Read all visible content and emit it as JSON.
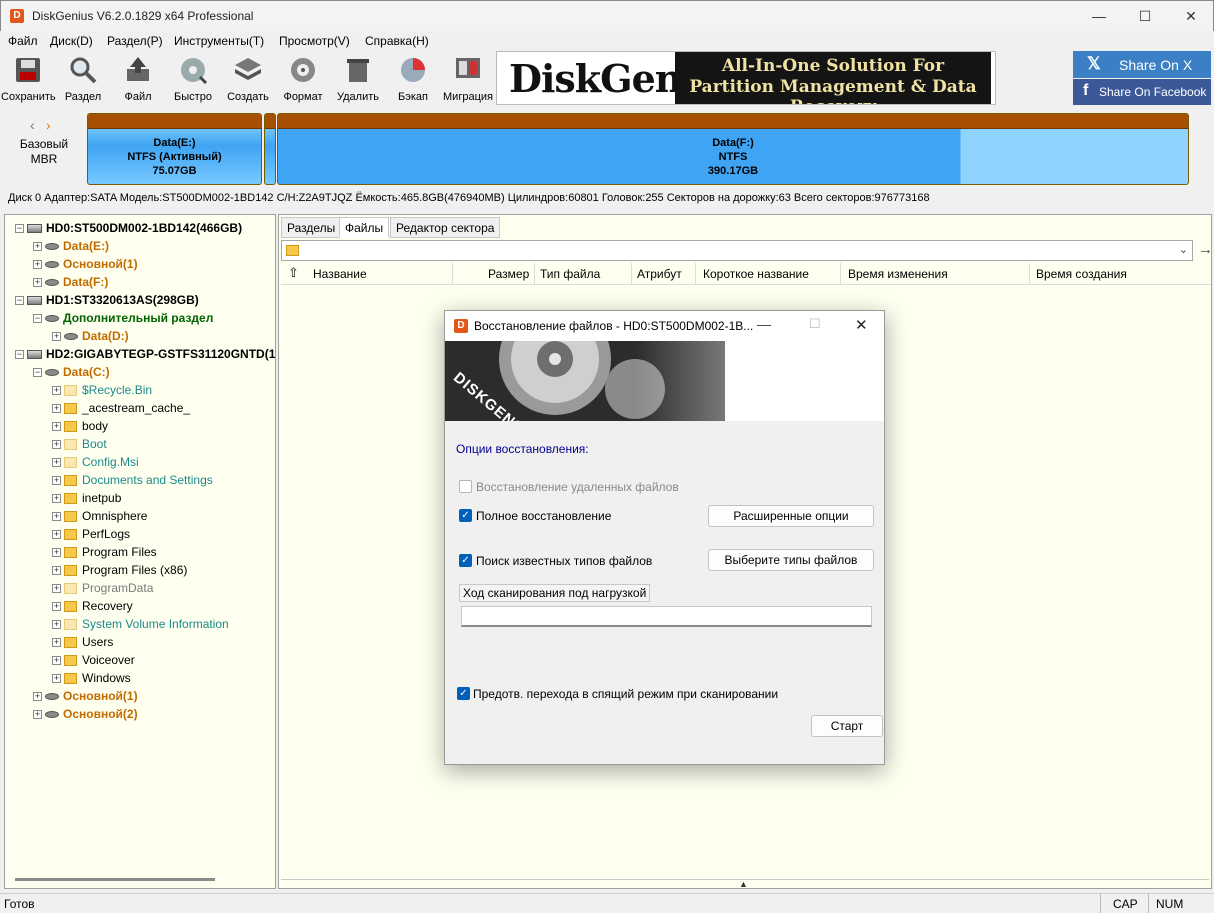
{
  "app": {
    "title": "DiskGenius V6.2.0.1829 x64 Professional",
    "icon_letter": "D"
  },
  "window_controls": {
    "minimize": "—",
    "maximize": "☐",
    "close": "✕"
  },
  "menu": [
    "Файл",
    "Диск(D)",
    "Раздел(P)",
    "Инструменты(T)",
    "Просмотр(V)",
    "Справка(H)"
  ],
  "toolbar": {
    "buttons": [
      {
        "label": "Сохранить",
        "icon": "save-icon"
      },
      {
        "label": "Раздел",
        "icon": "search-partition-icon"
      },
      {
        "label": "Файл",
        "icon": "file-recovery-icon"
      },
      {
        "label": "Быстро",
        "icon": "quick-partition-icon"
      },
      {
        "label": "Создать",
        "icon": "create-partition-icon"
      },
      {
        "label": "Формат",
        "icon": "format-icon"
      },
      {
        "label": "Удалить",
        "icon": "delete-icon"
      },
      {
        "label": "Бэкап",
        "icon": "backup-icon"
      },
      {
        "label": "Миграция",
        "icon": "migration-icon"
      }
    ]
  },
  "banner": {
    "logo": "DiskGenius",
    "tagline1": "All-In-One Solution For",
    "tagline2": "Partition Management & Data Recovery"
  },
  "share": {
    "x": "Share On X",
    "facebook": "Share On Facebook"
  },
  "disk_map": {
    "label_line1": "Базовый",
    "label_line2": "MBR",
    "partitions": [
      {
        "name": "Data(E:)",
        "fs": "NTFS (Активный)",
        "size": "75.07GB"
      },
      {
        "name": "Data(F:)",
        "fs": "NTFS",
        "size": "390.17GB"
      }
    ]
  },
  "disk_info": "Диск 0 Адаптер:SATA Модель:ST500DM002-1BD142 С/Н:Z2A9TJQZ Ёмкость:465.8GB(476940MB) Цилиндров:60801 Головок:255 Секторов на дорожку:63 Всего секторов:976773168",
  "tree": {
    "items": [
      {
        "text": "HD0:ST500DM002-1BD142(466GB)",
        "kind": "disk",
        "color": "c-disk",
        "level": 0,
        "expander": "−"
      },
      {
        "text": "Data(E:)",
        "kind": "part",
        "color": "c-orange",
        "level": 1,
        "expander": "+"
      },
      {
        "text": "Основной(1)",
        "kind": "part",
        "color": "c-orange",
        "level": 1,
        "expander": "+"
      },
      {
        "text": "Data(F:)",
        "kind": "part",
        "color": "c-orange",
        "level": 1,
        "expander": "+"
      },
      {
        "text": "HD1:ST3320613AS(298GB)",
        "kind": "disk",
        "color": "c-disk",
        "level": 0,
        "expander": "−"
      },
      {
        "text": "Дополнительный раздел",
        "kind": "ext",
        "color": "c-green",
        "level": 1,
        "expander": "−"
      },
      {
        "text": "Data(D:)",
        "kind": "part",
        "color": "c-orange",
        "level": 2,
        "expander": "+"
      },
      {
        "text": "HD2:GIGABYTEGP-GSTFS31120GNTD(1",
        "kind": "disk",
        "color": "c-disk",
        "level": 0,
        "expander": "−"
      },
      {
        "text": "Data(C:)",
        "kind": "part",
        "color": "c-orange",
        "level": 1,
        "expander": "−"
      },
      {
        "text": "$Recycle.Bin",
        "kind": "folder-pale",
        "color": "c-teal",
        "level": 2,
        "expander": "+"
      },
      {
        "text": "_acestream_cache_",
        "kind": "folder-link",
        "color": "c-black",
        "level": 2,
        "expander": "+"
      },
      {
        "text": "body",
        "kind": "folder",
        "color": "c-black",
        "level": 2,
        "expander": "+"
      },
      {
        "text": "Boot",
        "kind": "folder-pale",
        "color": "c-teal",
        "level": 2,
        "expander": "+"
      },
      {
        "text": "Config.Msi",
        "kind": "folder-pale",
        "color": "c-teal",
        "level": 2,
        "expander": "+"
      },
      {
        "text": "Documents and Settings",
        "kind": "folder-link",
        "color": "c-teal",
        "level": 2,
        "expander": "+"
      },
      {
        "text": "inetpub",
        "kind": "folder",
        "color": "c-black",
        "level": 2,
        "expander": "+"
      },
      {
        "text": "Omnisphere",
        "kind": "folder",
        "color": "c-black",
        "level": 2,
        "expander": "+"
      },
      {
        "text": "PerfLogs",
        "kind": "folder",
        "color": "c-black",
        "level": 2,
        "expander": "+"
      },
      {
        "text": "Program Files",
        "kind": "folder",
        "color": "c-black",
        "level": 2,
        "expander": "+"
      },
      {
        "text": "Program Files (x86)",
        "kind": "folder",
        "color": "c-black",
        "level": 2,
        "expander": "+"
      },
      {
        "text": "ProgramData",
        "kind": "folder-pale",
        "color": "c-gray",
        "level": 2,
        "expander": "+"
      },
      {
        "text": "Recovery",
        "kind": "folder",
        "color": "c-black",
        "level": 2,
        "expander": "+"
      },
      {
        "text": "System Volume Information",
        "kind": "folder-pale",
        "color": "c-teal",
        "level": 2,
        "expander": "+"
      },
      {
        "text": "Users",
        "kind": "folder",
        "color": "c-black",
        "level": 2,
        "expander": "+"
      },
      {
        "text": "Voiceover",
        "kind": "folder",
        "color": "c-black",
        "level": 2,
        "expander": "+"
      },
      {
        "text": "Windows",
        "kind": "folder",
        "color": "c-black",
        "level": 2,
        "expander": "+"
      },
      {
        "text": "Основной(1)",
        "kind": "part",
        "color": "c-orange",
        "level": 1,
        "expander": "+"
      },
      {
        "text": "Основной(2)",
        "kind": "part",
        "color": "c-orange",
        "level": 1,
        "expander": "+"
      }
    ]
  },
  "tabs": [
    "Разделы",
    "Файлы",
    "Редактор сектора"
  ],
  "active_tab": "Файлы",
  "path_value": "",
  "columns": [
    "Название",
    "Размер",
    "Тип файла",
    "Атрибут",
    "Короткое название",
    "Время изменения",
    "Время создания"
  ],
  "status": {
    "left": "Готов",
    "cap": "CAP",
    "num": "NUM"
  },
  "dialog": {
    "title": "Восстановление файлов - HD0:ST500DM002-1B...",
    "banner_text": "DISKGENIUS",
    "section_label": "Опции восстановления:",
    "opt_deleted": {
      "label": "Восстановление удаленных файлов",
      "checked": false
    },
    "opt_full": {
      "label": "Полное восстановление",
      "checked": true
    },
    "advanced_button": "Расширенные опции",
    "opt_known_types": {
      "label": "Поиск известных типов файлов",
      "checked": true
    },
    "select_types_button": "Выберите типы файлов",
    "progress_label": "Ход сканирования под нагрузкой",
    "progress": 0,
    "opt_prevent_sleep": {
      "label": "Предотв. перехода в спящий режим при сканировании",
      "checked": true
    },
    "start_button": "Старт"
  },
  "colors": {
    "accent": "#005fb8",
    "partition_top": "#a64f00",
    "partition_fill": "#3fa4f3",
    "tree_bg": "#fffff0"
  }
}
